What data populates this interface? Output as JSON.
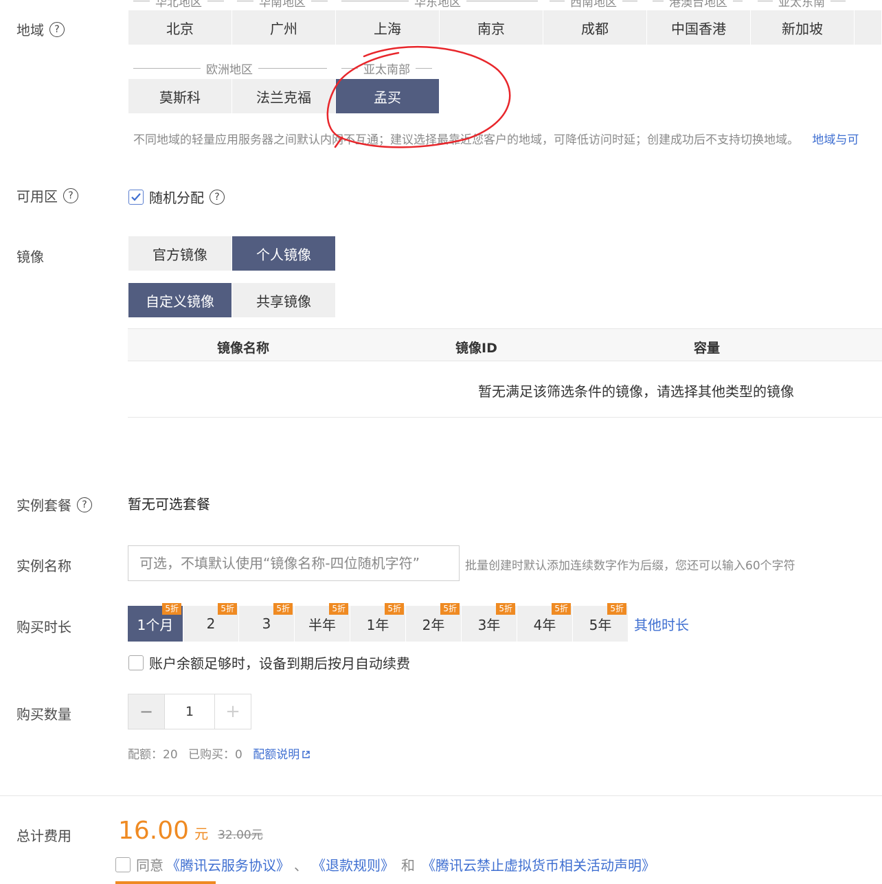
{
  "region": {
    "label": "地域",
    "help_icon": "?",
    "top_group_labels": [
      "华北地区",
      "华南地区",
      "华东地区",
      "西南地区",
      "港澳台地区",
      "亚太东南"
    ],
    "top_cities": [
      "北京",
      "广州",
      "上海",
      "南京",
      "成都",
      "中国香港",
      "新加坡"
    ],
    "europe_label": "欧洲地区",
    "apac_south_label": "亚太南部",
    "bottom_cities": [
      "莫斯科",
      "法兰克福",
      "孟买"
    ],
    "selected": "孟买",
    "hint": "不同地域的轻量应用服务器之间默认内网不互通；建议选择最靠近您客户的地域，可降低访问时延；创建成功后不支持切换地域。",
    "hint_link": "地域与可"
  },
  "zone": {
    "label": "可用区",
    "random_label": "随机分配",
    "random_checked": true
  },
  "image": {
    "label": "镜像",
    "tabs": [
      "官方镜像",
      "个人镜像"
    ],
    "active_tab": "个人镜像",
    "subtabs": [
      "自定义镜像",
      "共享镜像"
    ],
    "active_subtab": "自定义镜像",
    "columns": [
      "镜像名称",
      "镜像ID",
      "容量"
    ],
    "empty_text": "暂无满足该筛选条件的镜像，请选择其他类型的镜像"
  },
  "package": {
    "label": "实例套餐",
    "value": "暂无可选套餐"
  },
  "instance_name": {
    "label": "实例名称",
    "placeholder": "可选，不填默认使用“镜像名称-四位随机字符”",
    "hint": "批量创建时默认添加连续数字作为后缀，您还可以输入60个字符"
  },
  "duration": {
    "label": "购买时长",
    "options": [
      "1个月",
      "2",
      "3",
      "半年",
      "1年",
      "2年",
      "3年",
      "4年",
      "5年"
    ],
    "badge": "5折",
    "selected": "1个月",
    "other": "其他时长",
    "auto_renew_label": "账户余额足够时，设备到期后按月自动续费",
    "auto_renew_checked": false
  },
  "quantity": {
    "label": "购买数量",
    "minus": "−",
    "value": "1",
    "plus": "+",
    "quota_label": "配额：",
    "quota_value": "20",
    "purchased_label": "已购买：",
    "purchased_value": "0",
    "quota_link": "配额说明"
  },
  "total": {
    "label": "总计费用",
    "price": "16.00",
    "unit": "元",
    "original": "32.00元",
    "agree_label": "同意",
    "agreement1": "《腾讯云服务协议》",
    "sep": "、",
    "agreement2": "《退款规则》",
    "and": "和",
    "agreement3": "《腾讯云禁止虚拟货币相关活动声明》"
  },
  "colors": {
    "active_bg": "#525d80",
    "inactive_bg": "#efefef",
    "link": "#3f6fd1",
    "price": "#ef8a22",
    "annotation": "#e8262b"
  }
}
